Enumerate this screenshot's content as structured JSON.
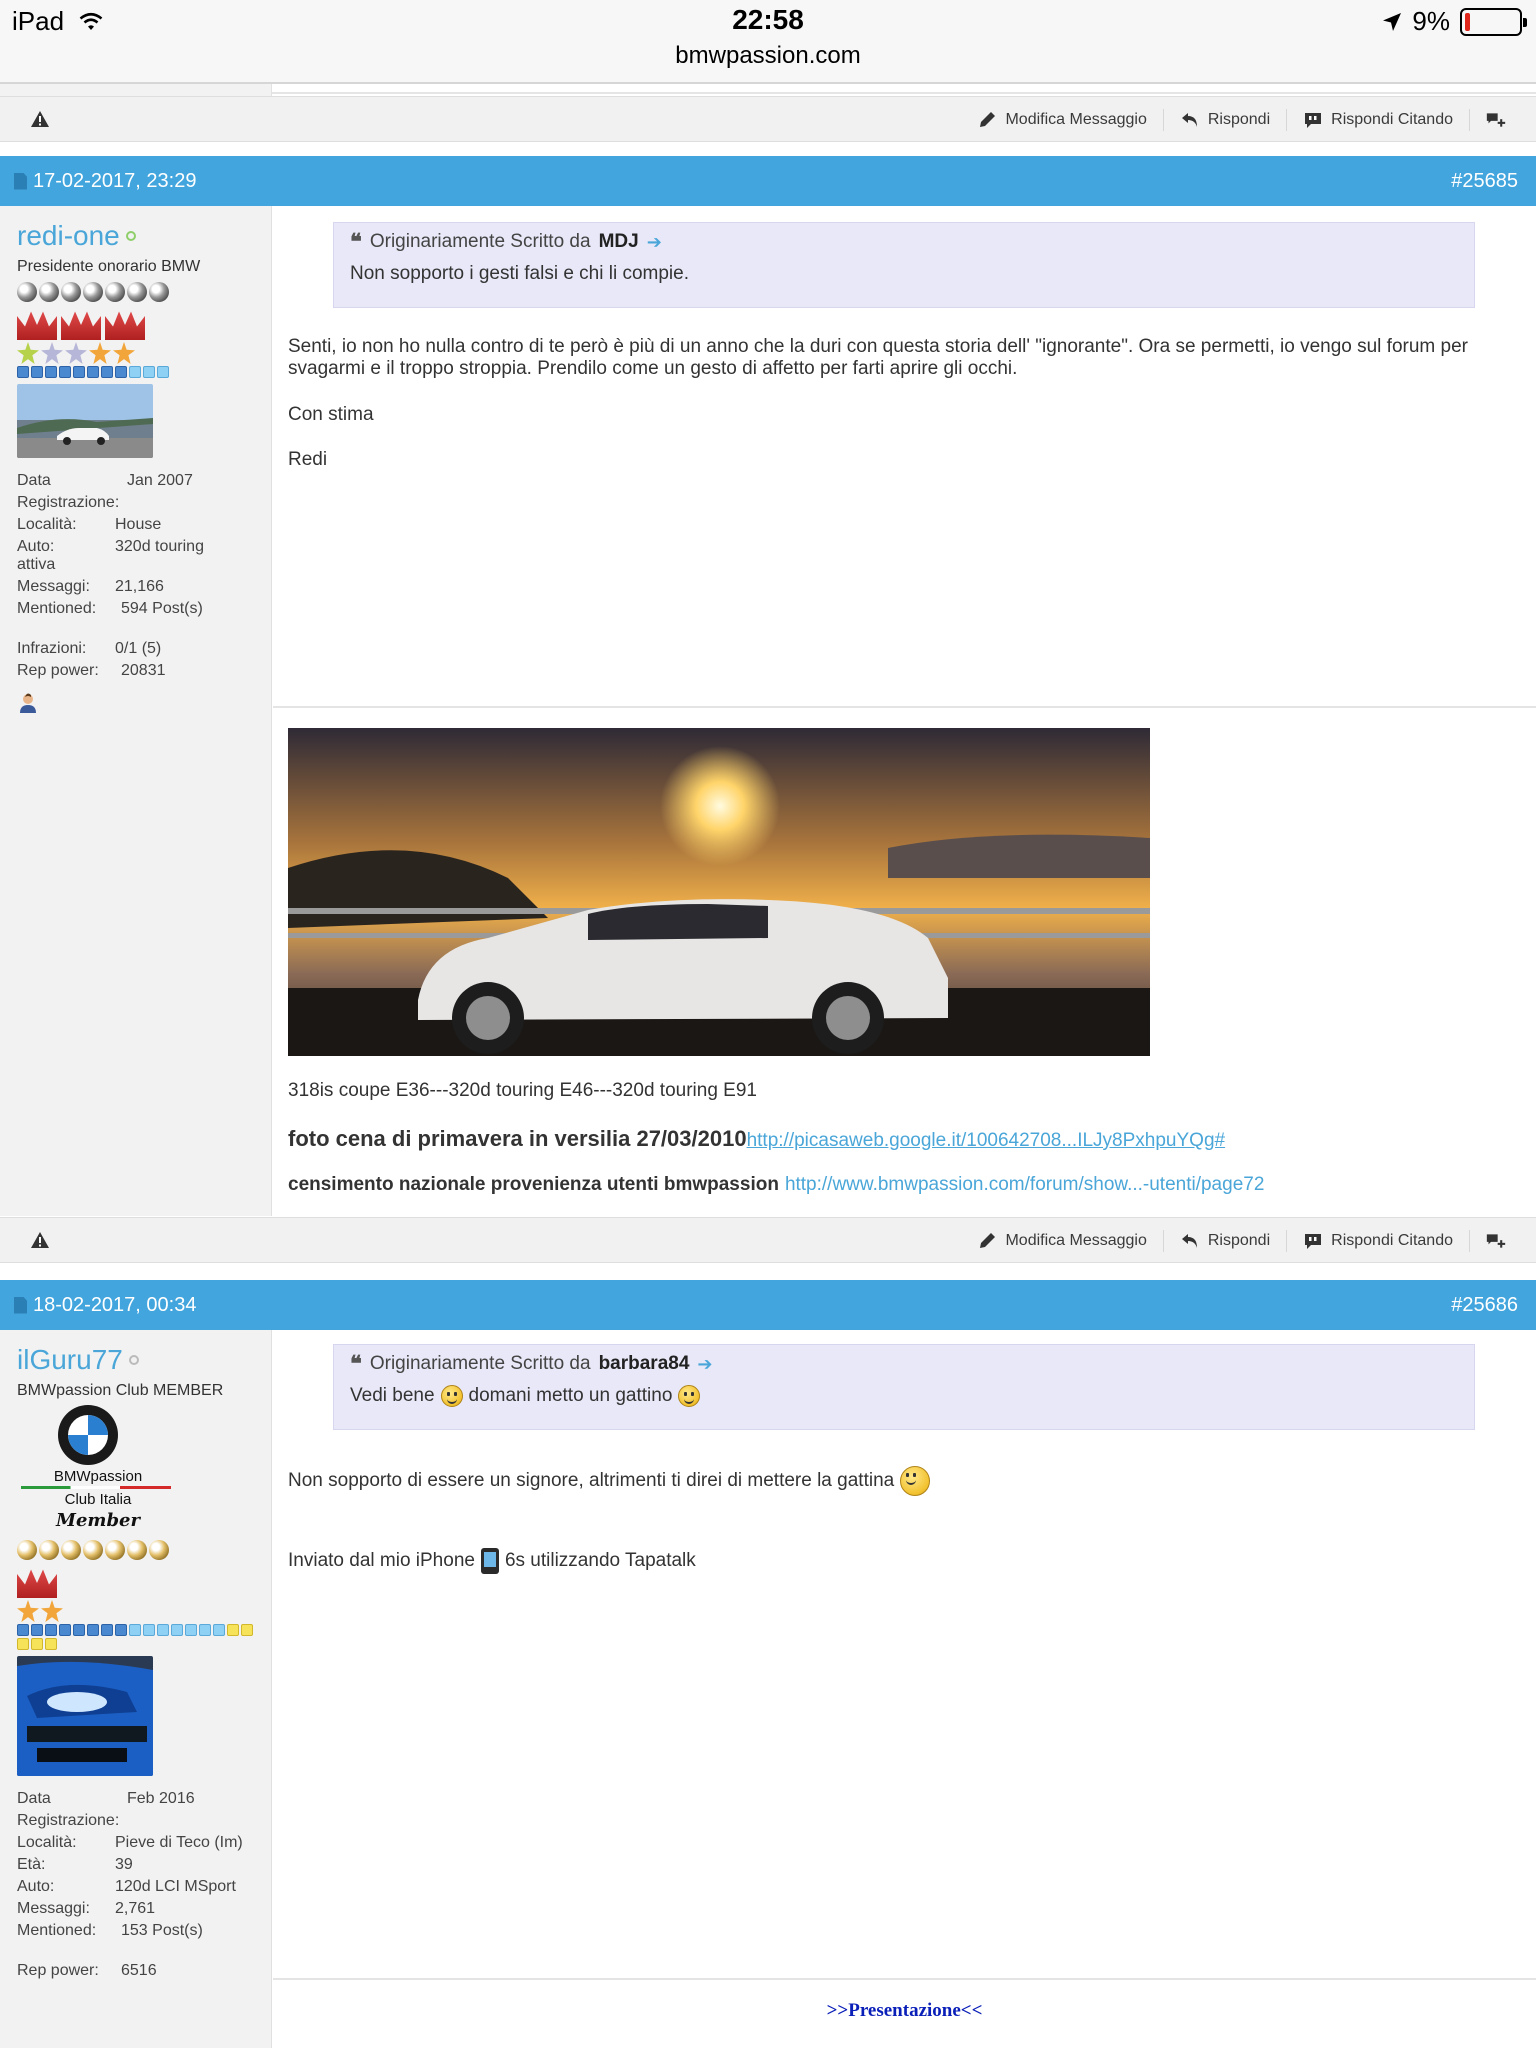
{
  "status_bar": {
    "device": "iPad",
    "time": "22:58",
    "url": "bmwpassion.com",
    "battery": "9%",
    "battery_level": 0.09
  },
  "post_actions": {
    "edit": "Modifica Messaggio",
    "reply": "Rispondi",
    "quote": "Rispondi Citando"
  },
  "posts": [
    {
      "date": "17-02-2017, 23:29",
      "number": "#25685",
      "user": {
        "name": "redi-one",
        "title": "Presidente onorario BMW",
        "stats": [
          {
            "k": "Data Registrazione:",
            "v": "Jan 2007"
          },
          {
            "k": "Località:",
            "v": "House"
          },
          {
            "k": "Auto:",
            "v": "320d touring"
          },
          {
            "k": "",
            "v": "attiva"
          },
          {
            "k": "Messaggi:",
            "v": "21,166"
          },
          {
            "k": "Mentioned:",
            "v": "594 Post(s)"
          }
        ],
        "stats2": [
          {
            "k": "Infrazioni:",
            "v": "0/1 (5)"
          },
          {
            "k": "Rep power:",
            "v": "20831"
          }
        ]
      },
      "quote": {
        "prefix": "Originariamente Scritto da",
        "author": "MDJ",
        "text": "Non sopporto i gesti falsi e chi li compie."
      },
      "body": [
        "Senti, io non ho nulla contro di te però è più di un anno che la duri con questa storia dell' \"ignorante\". Ora se permetti, io vengo sul forum per svagarmi e il troppo stroppia. Prendilo come un gesto di affetto per farti aprire gli occhi.",
        "Con stima",
        "Redi"
      ],
      "signature": {
        "cars": "318is coupe E36---320d touring E46---320d touring E91",
        "photo_text": "foto cena di primavera in versilia 27/03/2010",
        "photo_link": "http://picasaweb.google.it/100642708...ILJy8PxhpuYQg#",
        "census_text": "censimento nazionale provenienza utenti bmwpassion",
        "census_link": "http://www.bmwpassion.com/forum/show...-utenti/page72"
      }
    },
    {
      "date": "18-02-2017, 00:34",
      "number": "#25686",
      "user": {
        "name": "ilGuru77",
        "title": "BMWpassion Club MEMBER",
        "badge": {
          "line1": "BMWpassion",
          "line2": "Club Italia",
          "line3": "Member"
        },
        "stats": [
          {
            "k": "Data Registrazione:",
            "v": "Feb 2016"
          },
          {
            "k": "Località:",
            "v": "Pieve di Teco (Im)"
          },
          {
            "k": "Età:",
            "v": "39"
          },
          {
            "k": "Auto:",
            "v": "120d LCI MSport"
          },
          {
            "k": "Messaggi:",
            "v": "2,761"
          },
          {
            "k": "Mentioned:",
            "v": "153 Post(s)"
          }
        ],
        "stats2": [
          {
            "k": "Rep power:",
            "v": "6516"
          }
        ]
      },
      "quote": {
        "prefix": "Originariamente Scritto da",
        "author": "barbara84",
        "text_a": "Vedi bene",
        "text_b": "domani metto un gattino"
      },
      "body_1": "Non sopporto di essere un signore, altrimenti ti direi di mettere la gattina",
      "body_2a": "Inviato dal mio iPhone",
      "body_2b": "6s utilizzando Tapatalk",
      "footer_link": ">>Presentazione<<"
    }
  ]
}
